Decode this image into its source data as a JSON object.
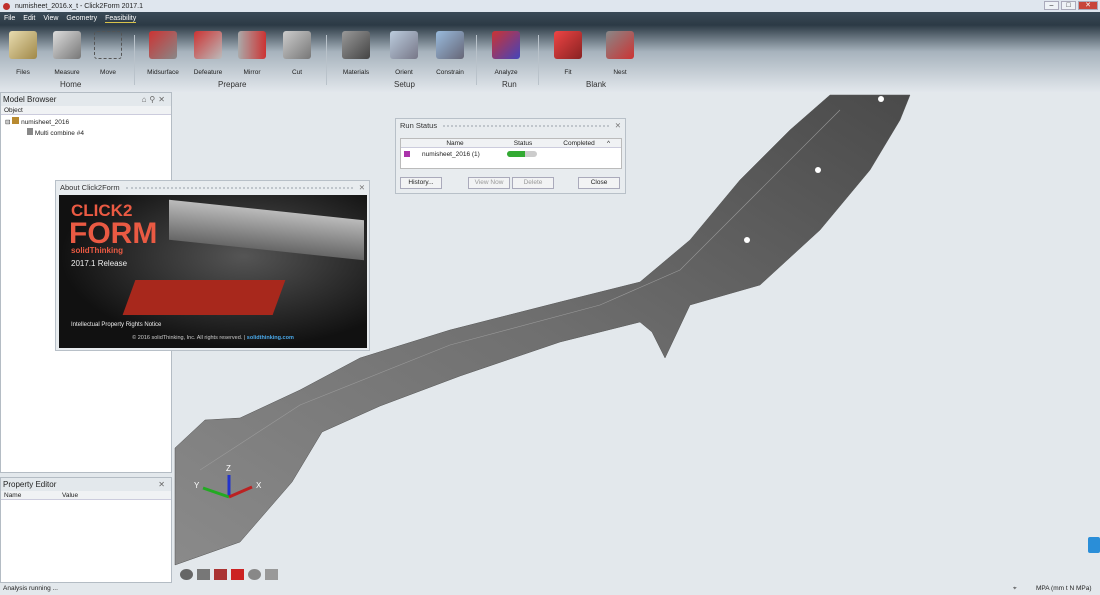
{
  "window": {
    "title": "numisheet_2016.x_t - Click2Form 2017.1"
  },
  "menu": [
    "File",
    "Edit",
    "View",
    "Geometry",
    "Feasibility"
  ],
  "ribbon": {
    "tools": [
      "Files",
      "Measure",
      "Move",
      "Midsurface",
      "Defeature",
      "Mirror",
      "Cut",
      "Materials",
      "Orient",
      "Constrain",
      "Analyze",
      "Fit",
      "Nest"
    ],
    "groups": [
      "Home",
      "Prepare",
      "Setup",
      "Run",
      "Blank"
    ]
  },
  "model_browser": {
    "title": "Model Browser",
    "column": "Object",
    "root": "numisheet_2016",
    "child": "Multi combine #4"
  },
  "property_editor": {
    "title": "Property Editor",
    "columns": [
      "Name",
      "Value"
    ]
  },
  "run_status": {
    "title": "Run Status",
    "columns": [
      "Name",
      "Status",
      "Completed"
    ],
    "row": {
      "name": "numisheet_2016 (1)",
      "progress": 0.6
    },
    "buttons": {
      "history": "History...",
      "view_now": "View Now",
      "delete": "Delete",
      "close": "Close"
    }
  },
  "about": {
    "title": "About Click2Form",
    "brand1": "CLICK2",
    "brand2": "FORM",
    "brand3": "solidThinking",
    "release": "2017.1 Release",
    "notice": "Intellectual Property Rights Notice",
    "copyright": "© 2016 solidThinking, Inc. All rights reserved.  |",
    "link": "solidthinking.com"
  },
  "axes": {
    "x": "X",
    "y": "Y",
    "z": "Z"
  },
  "status": {
    "left": "Analysis running ...",
    "units": "MPA (mm t N MPa)"
  }
}
